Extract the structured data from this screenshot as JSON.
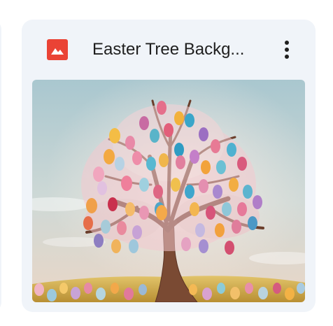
{
  "card": {
    "title": "Easter Tree Backg...",
    "file_type_icon": "image-file-icon",
    "more_icon": "more-vert-icon",
    "thumbnail_subject": "easter-tree-thumbnail"
  },
  "colors": {
    "card_background": "#f0f4f9",
    "image_icon_red": "#ea4335",
    "title_text": "#1f1f1f",
    "sky_top": "#a9c7cf",
    "sky_bottom": "#e9d6c8",
    "ground": "#d9b24a"
  }
}
